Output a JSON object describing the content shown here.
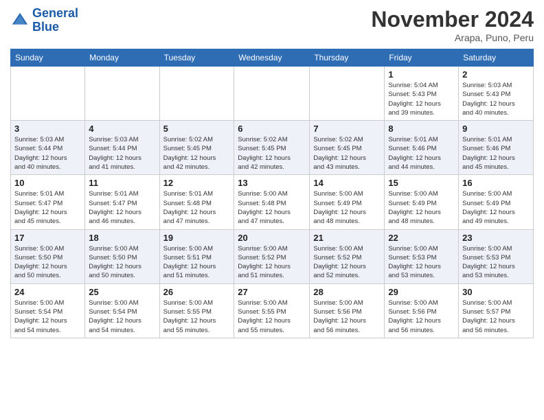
{
  "header": {
    "logo_line1": "General",
    "logo_line2": "Blue",
    "month": "November 2024",
    "location": "Arapa, Puno, Peru"
  },
  "weekdays": [
    "Sunday",
    "Monday",
    "Tuesday",
    "Wednesday",
    "Thursday",
    "Friday",
    "Saturday"
  ],
  "weeks": [
    [
      {
        "day": "",
        "info": ""
      },
      {
        "day": "",
        "info": ""
      },
      {
        "day": "",
        "info": ""
      },
      {
        "day": "",
        "info": ""
      },
      {
        "day": "",
        "info": ""
      },
      {
        "day": "1",
        "info": "Sunrise: 5:04 AM\nSunset: 5:43 PM\nDaylight: 12 hours\nand 39 minutes."
      },
      {
        "day": "2",
        "info": "Sunrise: 5:03 AM\nSunset: 5:43 PM\nDaylight: 12 hours\nand 40 minutes."
      }
    ],
    [
      {
        "day": "3",
        "info": "Sunrise: 5:03 AM\nSunset: 5:44 PM\nDaylight: 12 hours\nand 40 minutes."
      },
      {
        "day": "4",
        "info": "Sunrise: 5:03 AM\nSunset: 5:44 PM\nDaylight: 12 hours\nand 41 minutes."
      },
      {
        "day": "5",
        "info": "Sunrise: 5:02 AM\nSunset: 5:45 PM\nDaylight: 12 hours\nand 42 minutes."
      },
      {
        "day": "6",
        "info": "Sunrise: 5:02 AM\nSunset: 5:45 PM\nDaylight: 12 hours\nand 42 minutes."
      },
      {
        "day": "7",
        "info": "Sunrise: 5:02 AM\nSunset: 5:45 PM\nDaylight: 12 hours\nand 43 minutes."
      },
      {
        "day": "8",
        "info": "Sunrise: 5:01 AM\nSunset: 5:46 PM\nDaylight: 12 hours\nand 44 minutes."
      },
      {
        "day": "9",
        "info": "Sunrise: 5:01 AM\nSunset: 5:46 PM\nDaylight: 12 hours\nand 45 minutes."
      }
    ],
    [
      {
        "day": "10",
        "info": "Sunrise: 5:01 AM\nSunset: 5:47 PM\nDaylight: 12 hours\nand 45 minutes."
      },
      {
        "day": "11",
        "info": "Sunrise: 5:01 AM\nSunset: 5:47 PM\nDaylight: 12 hours\nand 46 minutes."
      },
      {
        "day": "12",
        "info": "Sunrise: 5:01 AM\nSunset: 5:48 PM\nDaylight: 12 hours\nand 47 minutes."
      },
      {
        "day": "13",
        "info": "Sunrise: 5:00 AM\nSunset: 5:48 PM\nDaylight: 12 hours\nand 47 minutes."
      },
      {
        "day": "14",
        "info": "Sunrise: 5:00 AM\nSunset: 5:49 PM\nDaylight: 12 hours\nand 48 minutes."
      },
      {
        "day": "15",
        "info": "Sunrise: 5:00 AM\nSunset: 5:49 PM\nDaylight: 12 hours\nand 48 minutes."
      },
      {
        "day": "16",
        "info": "Sunrise: 5:00 AM\nSunset: 5:49 PM\nDaylight: 12 hours\nand 49 minutes."
      }
    ],
    [
      {
        "day": "17",
        "info": "Sunrise: 5:00 AM\nSunset: 5:50 PM\nDaylight: 12 hours\nand 50 minutes."
      },
      {
        "day": "18",
        "info": "Sunrise: 5:00 AM\nSunset: 5:50 PM\nDaylight: 12 hours\nand 50 minutes."
      },
      {
        "day": "19",
        "info": "Sunrise: 5:00 AM\nSunset: 5:51 PM\nDaylight: 12 hours\nand 51 minutes."
      },
      {
        "day": "20",
        "info": "Sunrise: 5:00 AM\nSunset: 5:52 PM\nDaylight: 12 hours\nand 51 minutes."
      },
      {
        "day": "21",
        "info": "Sunrise: 5:00 AM\nSunset: 5:52 PM\nDaylight: 12 hours\nand 52 minutes."
      },
      {
        "day": "22",
        "info": "Sunrise: 5:00 AM\nSunset: 5:53 PM\nDaylight: 12 hours\nand 53 minutes."
      },
      {
        "day": "23",
        "info": "Sunrise: 5:00 AM\nSunset: 5:53 PM\nDaylight: 12 hours\nand 53 minutes."
      }
    ],
    [
      {
        "day": "24",
        "info": "Sunrise: 5:00 AM\nSunset: 5:54 PM\nDaylight: 12 hours\nand 54 minutes."
      },
      {
        "day": "25",
        "info": "Sunrise: 5:00 AM\nSunset: 5:54 PM\nDaylight: 12 hours\nand 54 minutes."
      },
      {
        "day": "26",
        "info": "Sunrise: 5:00 AM\nSunset: 5:55 PM\nDaylight: 12 hours\nand 55 minutes."
      },
      {
        "day": "27",
        "info": "Sunrise: 5:00 AM\nSunset: 5:55 PM\nDaylight: 12 hours\nand 55 minutes."
      },
      {
        "day": "28",
        "info": "Sunrise: 5:00 AM\nSunset: 5:56 PM\nDaylight: 12 hours\nand 56 minutes."
      },
      {
        "day": "29",
        "info": "Sunrise: 5:00 AM\nSunset: 5:56 PM\nDaylight: 12 hours\nand 56 minutes."
      },
      {
        "day": "30",
        "info": "Sunrise: 5:00 AM\nSunset: 5:57 PM\nDaylight: 12 hours\nand 56 minutes."
      }
    ]
  ]
}
